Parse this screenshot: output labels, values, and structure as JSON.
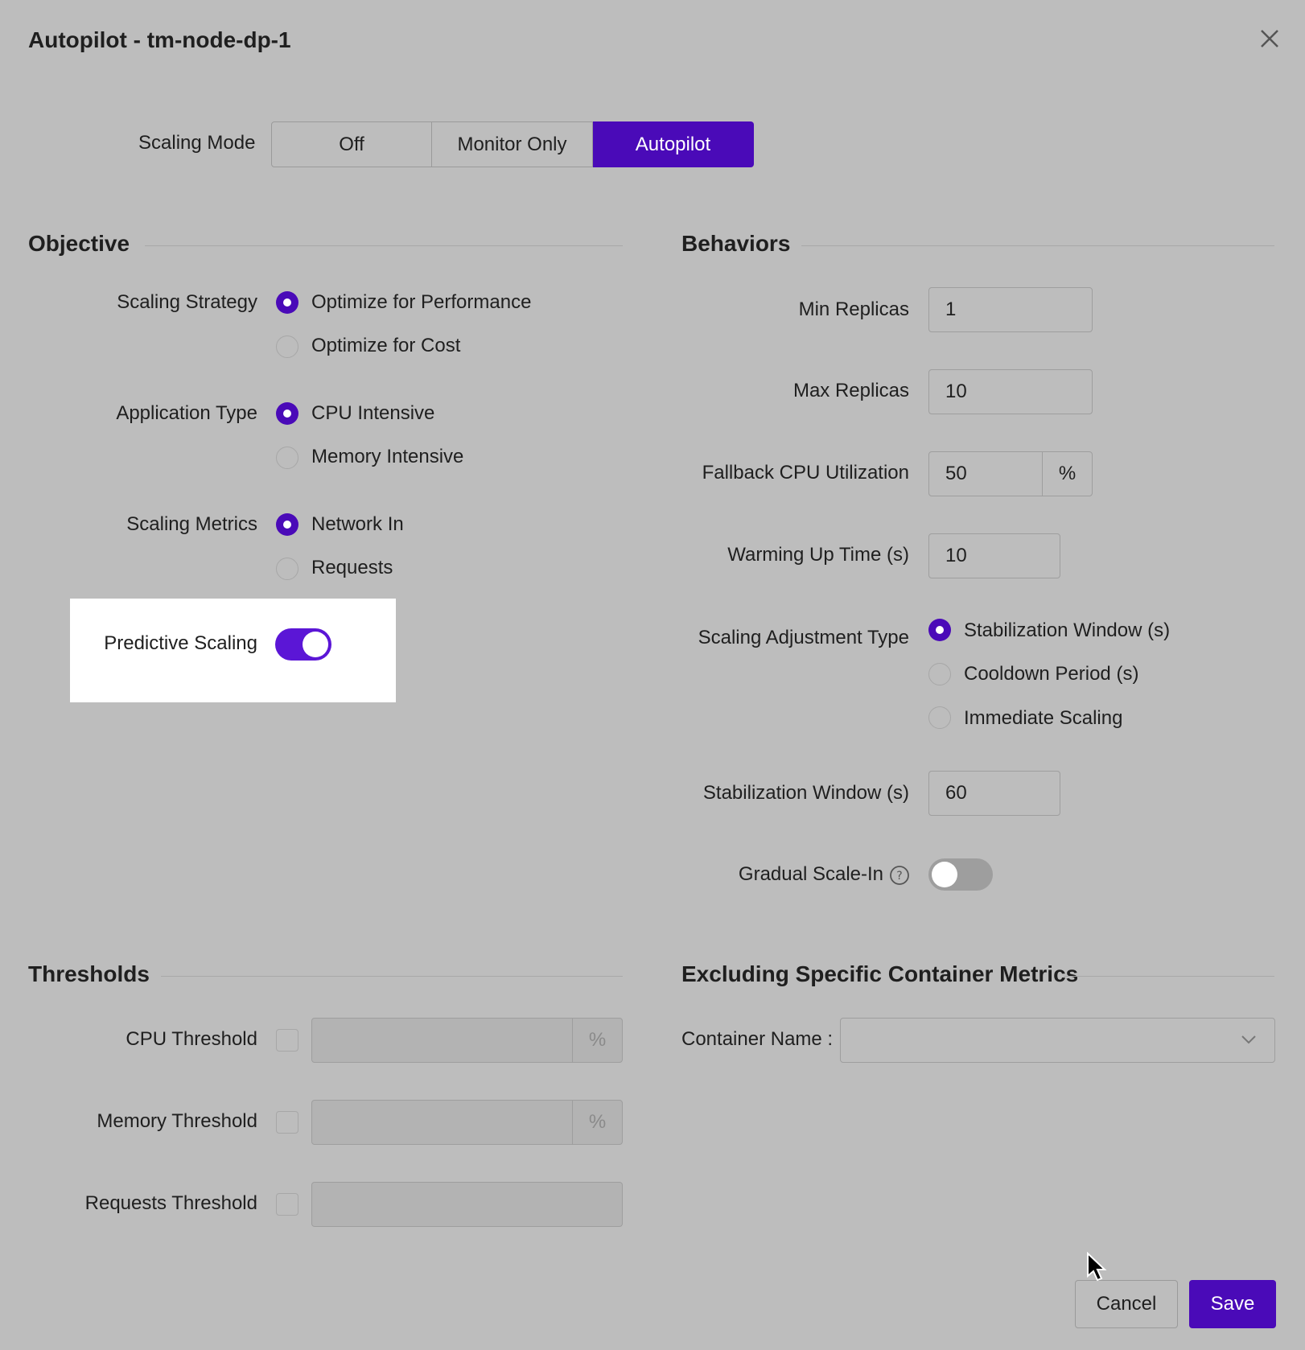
{
  "dialog": {
    "title": "Autopilot - tm-node-dp-1",
    "close_icon": "close-icon"
  },
  "scaling_mode": {
    "label": "Scaling Mode",
    "options": [
      "Off",
      "Monitor Only",
      "Autopilot"
    ],
    "selected": "Autopilot"
  },
  "objective": {
    "heading": "Objective",
    "scaling_strategy": {
      "label": "Scaling Strategy",
      "options": [
        "Optimize for Performance",
        "Optimize for Cost"
      ],
      "selected": "Optimize for Performance"
    },
    "application_type": {
      "label": "Application Type",
      "options": [
        "CPU Intensive",
        "Memory Intensive"
      ],
      "selected": "CPU Intensive"
    },
    "scaling_metrics": {
      "label": "Scaling Metrics",
      "options": [
        "Network In",
        "Requests"
      ],
      "selected": "Network In"
    },
    "predictive_scaling": {
      "label": "Predictive Scaling",
      "enabled": true
    }
  },
  "behaviors": {
    "heading": "Behaviors",
    "min_replicas": {
      "label": "Min Replicas",
      "value": "1"
    },
    "max_replicas": {
      "label": "Max Replicas",
      "value": "10"
    },
    "fallback_cpu": {
      "label": "Fallback CPU Utilization",
      "value": "50",
      "unit": "%"
    },
    "warming_up": {
      "label": "Warming Up Time (s)",
      "value": "10"
    },
    "adjustment_type": {
      "label": "Scaling Adjustment Type",
      "options": [
        "Stabilization Window (s)",
        "Cooldown Period (s)",
        "Immediate Scaling"
      ],
      "selected": "Stabilization Window (s)"
    },
    "stabilization_window": {
      "label": "Stabilization Window (s)",
      "value": "60"
    },
    "gradual_scale_in": {
      "label": "Gradual Scale-In",
      "enabled": false,
      "help_icon": "help-icon"
    }
  },
  "thresholds": {
    "heading": "Thresholds",
    "cpu": {
      "label": "CPU Threshold",
      "unit": "%",
      "value": ""
    },
    "memory": {
      "label": "Memory Threshold",
      "unit": "%",
      "value": ""
    },
    "requests": {
      "label": "Requests Threshold",
      "value": ""
    }
  },
  "excluding": {
    "heading": "Excluding Specific Container Metrics",
    "container_name": {
      "label": "Container Name :",
      "value": "",
      "dropdown_icon": "chevron-down-icon"
    }
  },
  "footer": {
    "cancel_label": "Cancel",
    "save_label": "Save"
  },
  "colors": {
    "accent": "#4a0ab8",
    "overlay_bg": "#bdbdbd",
    "highlight_bg": "#ffffff"
  }
}
